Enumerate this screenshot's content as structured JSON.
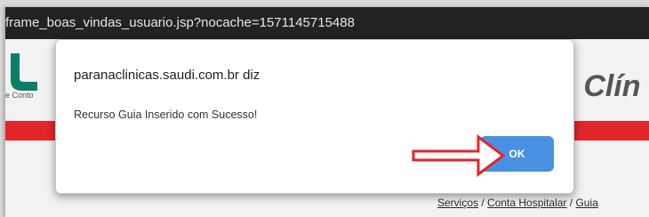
{
  "window": {
    "title": "frame_boas_vindas_usuario.jsp?nocache=1571145715488"
  },
  "page": {
    "logo_sub": "e Conto",
    "brand_text": "á Clín",
    "breadcrumb": {
      "items": [
        "Serviços",
        "Conta Hospitalar",
        "Guia"
      ],
      "separator": " / "
    },
    "colors": {
      "red_bar": "#e3262a",
      "title_bar": "#222222"
    }
  },
  "dialog": {
    "title": "paranaclinicas.saudi.com.br diz",
    "message": "Recurso Guia Inserido com Sucesso!",
    "ok_label": "OK",
    "colors": {
      "ok_button": "#4a90e2",
      "arrow_outline": "#e3262a"
    }
  }
}
